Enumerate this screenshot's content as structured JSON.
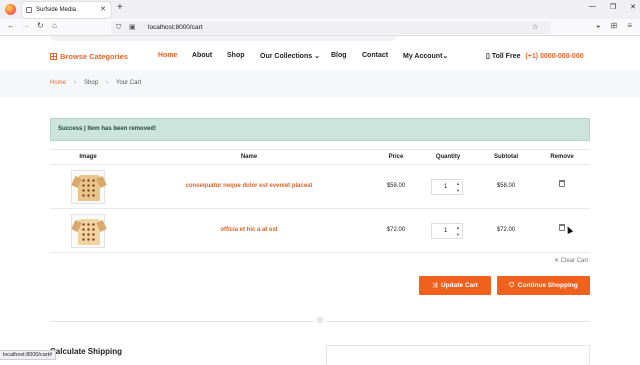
{
  "browser": {
    "tab_title": "Surfside Media",
    "url": "localhost:8000/cart",
    "status_url": "localhost:8000/cart#"
  },
  "header": {
    "browse_label": "Browse Categories",
    "menu": [
      "Home",
      "About",
      "Shop",
      "Our Collections",
      "Blog",
      "Contact",
      "My Account"
    ],
    "active_menu": "Home",
    "tollfree_label": "Toll Free",
    "tollfree_number": "(+1) 0000-000-000"
  },
  "breadcrumb": [
    "Home",
    "Shop",
    "Your Cart"
  ],
  "alert": {
    "text": "Success | Item has been removed!"
  },
  "cart": {
    "columns": [
      "Image",
      "Name",
      "Price",
      "Quantity",
      "Subtotal",
      "Remove"
    ],
    "rows": [
      {
        "name": "consequatur neque dolor est eveniet placeat",
        "price": "$58.00",
        "qty": "1",
        "subtotal": "$58.00"
      },
      {
        "name": "officia et hic a at est",
        "price": "$72.00",
        "qty": "1",
        "subtotal": "$72.00"
      }
    ],
    "clear_label": "Clear Cart",
    "update_label": "Update Cart",
    "continue_label": "Continue Shopping"
  },
  "shipping": {
    "title": "Calculate Shipping"
  },
  "colors": {
    "accent": "#f0611e",
    "alert_bg": "#cde4dc"
  }
}
